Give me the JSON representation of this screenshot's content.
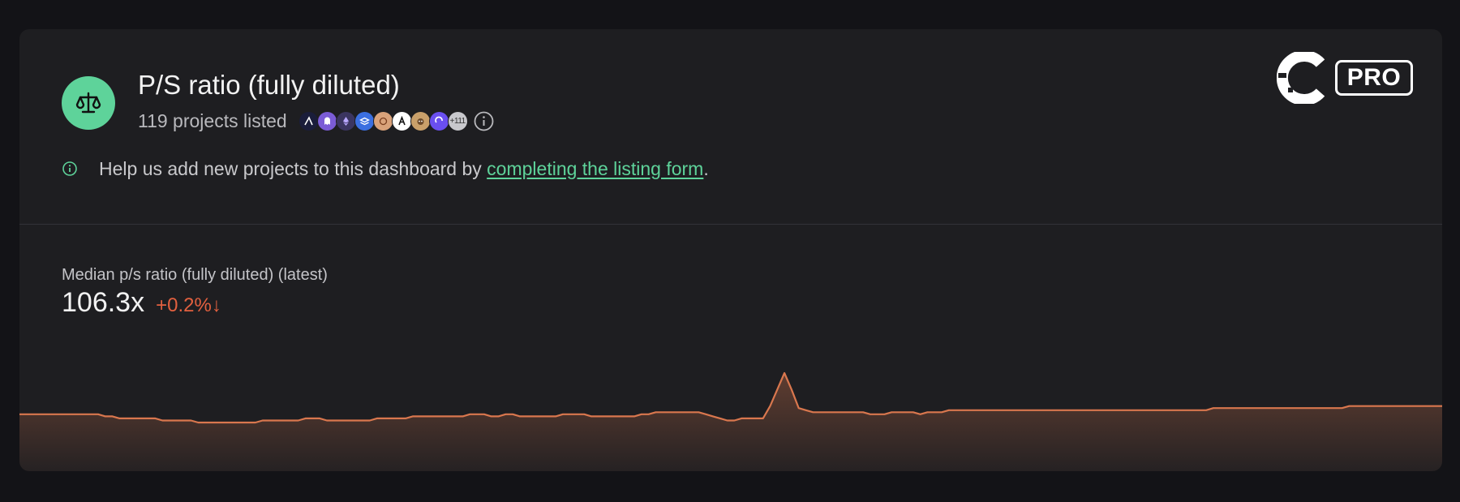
{
  "header": {
    "title": "P/S ratio (fully diluted)",
    "project_count": "119 projects listed",
    "more_badge": "+111",
    "icon": "scale-icon"
  },
  "notice": {
    "text_before": "Help us add new projects to this dashboard by ",
    "link": "completing the listing form",
    "text_after": "."
  },
  "brand": {
    "pro_label": "PRO"
  },
  "metric": {
    "label": "Median p/s ratio (fully diluted) (latest)",
    "value": "106.3x",
    "change": "+0.2%↓"
  },
  "colors": {
    "accent": "#5ed39a",
    "negative": "#e2603f",
    "line": "#d9774e"
  },
  "chart_data": {
    "type": "area",
    "title": "",
    "xlabel": "",
    "ylabel": "",
    "grid": false,
    "ylim": [
      0,
      150
    ],
    "values": [
      71,
      71,
      71,
      71,
      71,
      71,
      71,
      71,
      71,
      71,
      71,
      71,
      70,
      70,
      69,
      69,
      69,
      69,
      69,
      69,
      68,
      68,
      68,
      68,
      68,
      67,
      67,
      67,
      67,
      67,
      67,
      67,
      67,
      67,
      68,
      68,
      68,
      68,
      68,
      68,
      69,
      69,
      69,
      68,
      68,
      68,
      68,
      68,
      68,
      68,
      69,
      69,
      69,
      69,
      69,
      70,
      70,
      70,
      70,
      70,
      70,
      70,
      70,
      71,
      71,
      71,
      70,
      70,
      71,
      71,
      70,
      70,
      70,
      70,
      70,
      70,
      71,
      71,
      71,
      71,
      70,
      70,
      70,
      70,
      70,
      70,
      70,
      71,
      71,
      72,
      72,
      72,
      72,
      72,
      72,
      72,
      71,
      70,
      69,
      68,
      68,
      69,
      69,
      69,
      69,
      75,
      83,
      91,
      83,
      74,
      73,
      72,
      72,
      72,
      72,
      72,
      72,
      72,
      72,
      71,
      71,
      71,
      72,
      72,
      72,
      72,
      71,
      72,
      72,
      72,
      73,
      73,
      73,
      73,
      73,
      73,
      73,
      73,
      73,
      73,
      73,
      73,
      73,
      73,
      73,
      73,
      73,
      73,
      73,
      73,
      73,
      73,
      73,
      73,
      73,
      73,
      73,
      73,
      73,
      73,
      73,
      73,
      73,
      73,
      73,
      73,
      73,
      74,
      74,
      74,
      74,
      74,
      74,
      74,
      74,
      74,
      74,
      74,
      74,
      74,
      74,
      74,
      74,
      74,
      74,
      74,
      75,
      75,
      75,
      75,
      75,
      75,
      75,
      75,
      75,
      75,
      75,
      75,
      75,
      75
    ]
  }
}
